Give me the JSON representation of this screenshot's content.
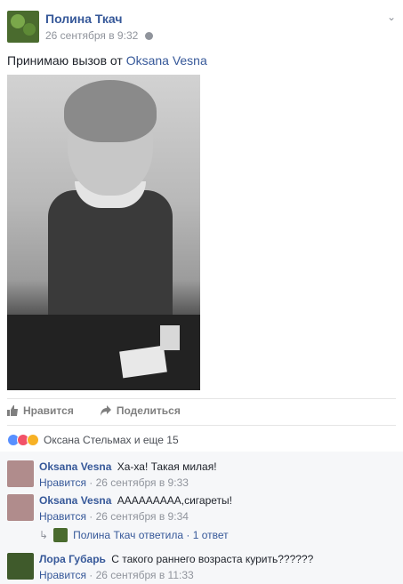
{
  "post": {
    "author": "Полина Ткач",
    "timestamp": "26 сентября в 9:32",
    "text_prefix": "Принимаю вызов от",
    "text_mention": "Oksana Vesna",
    "image_alt": "black-and-white photo of a toddler at a table"
  },
  "actions": {
    "like_label": "Нравится",
    "share_label": "Поделиться"
  },
  "reactions": {
    "summary": "Оксана Стельмах и еще 15",
    "icons": [
      "like-icon",
      "love-icon",
      "haha-icon"
    ],
    "colors": {
      "like": "#5890ff",
      "love": "#f25268",
      "haha": "#f7b125"
    }
  },
  "comments": [
    {
      "author": "Oksana Vesna",
      "text": "Ха-ха! Такая милая!",
      "like_label": "Нравится",
      "date": "· 26 сентября в 9:33"
    },
    {
      "author": "Oksana Vesna",
      "text": "ААААААААА,сигареты!",
      "like_label": "Нравится",
      "date": "· 26 сентября в 9:34"
    },
    {
      "author": "Лора Губарь",
      "text": "С такого раннего возраста курить??????",
      "like_label": "Нравится",
      "date": "· 26 сентября в 11:33"
    }
  ],
  "reply": {
    "text": "Полина Ткач ответила · 1 ответ"
  }
}
